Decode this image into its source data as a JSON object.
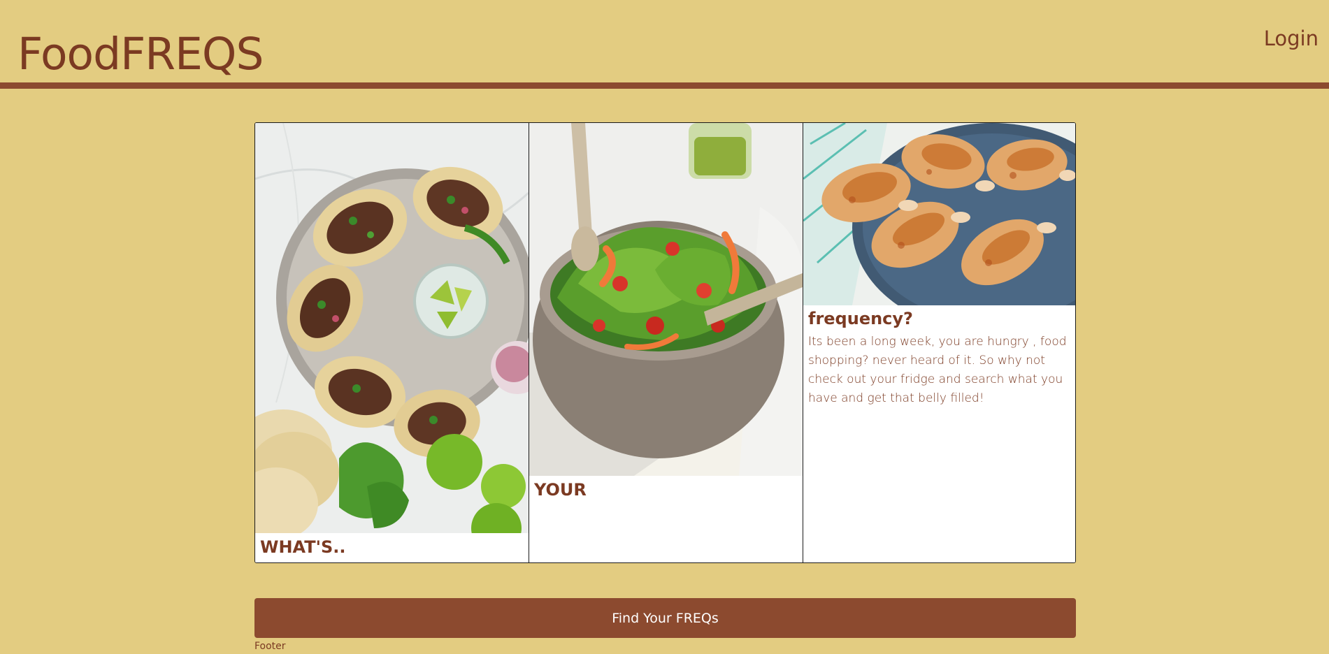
{
  "header": {
    "brand": "FoodFREQS",
    "login_label": "Login"
  },
  "cards": [
    {
      "title": "WHAT'S..",
      "text": "",
      "image": "tacos-photo"
    },
    {
      "title": "YOUR",
      "text": "",
      "image": "salad-photo"
    },
    {
      "title": "frequency?",
      "text": "Its been a long week, you are hungry , food shopping? never heard of it. So why not check out your fridge and search what you have and get that belly filled!",
      "image": "chicken-drumsticks-photo"
    }
  ],
  "cta": {
    "label": "Find Your FREQs"
  },
  "footer": {
    "text": "Footer"
  },
  "colors": {
    "background": "#e3cc81",
    "accent": "#8c4a2f",
    "text": "#7b3a22"
  }
}
